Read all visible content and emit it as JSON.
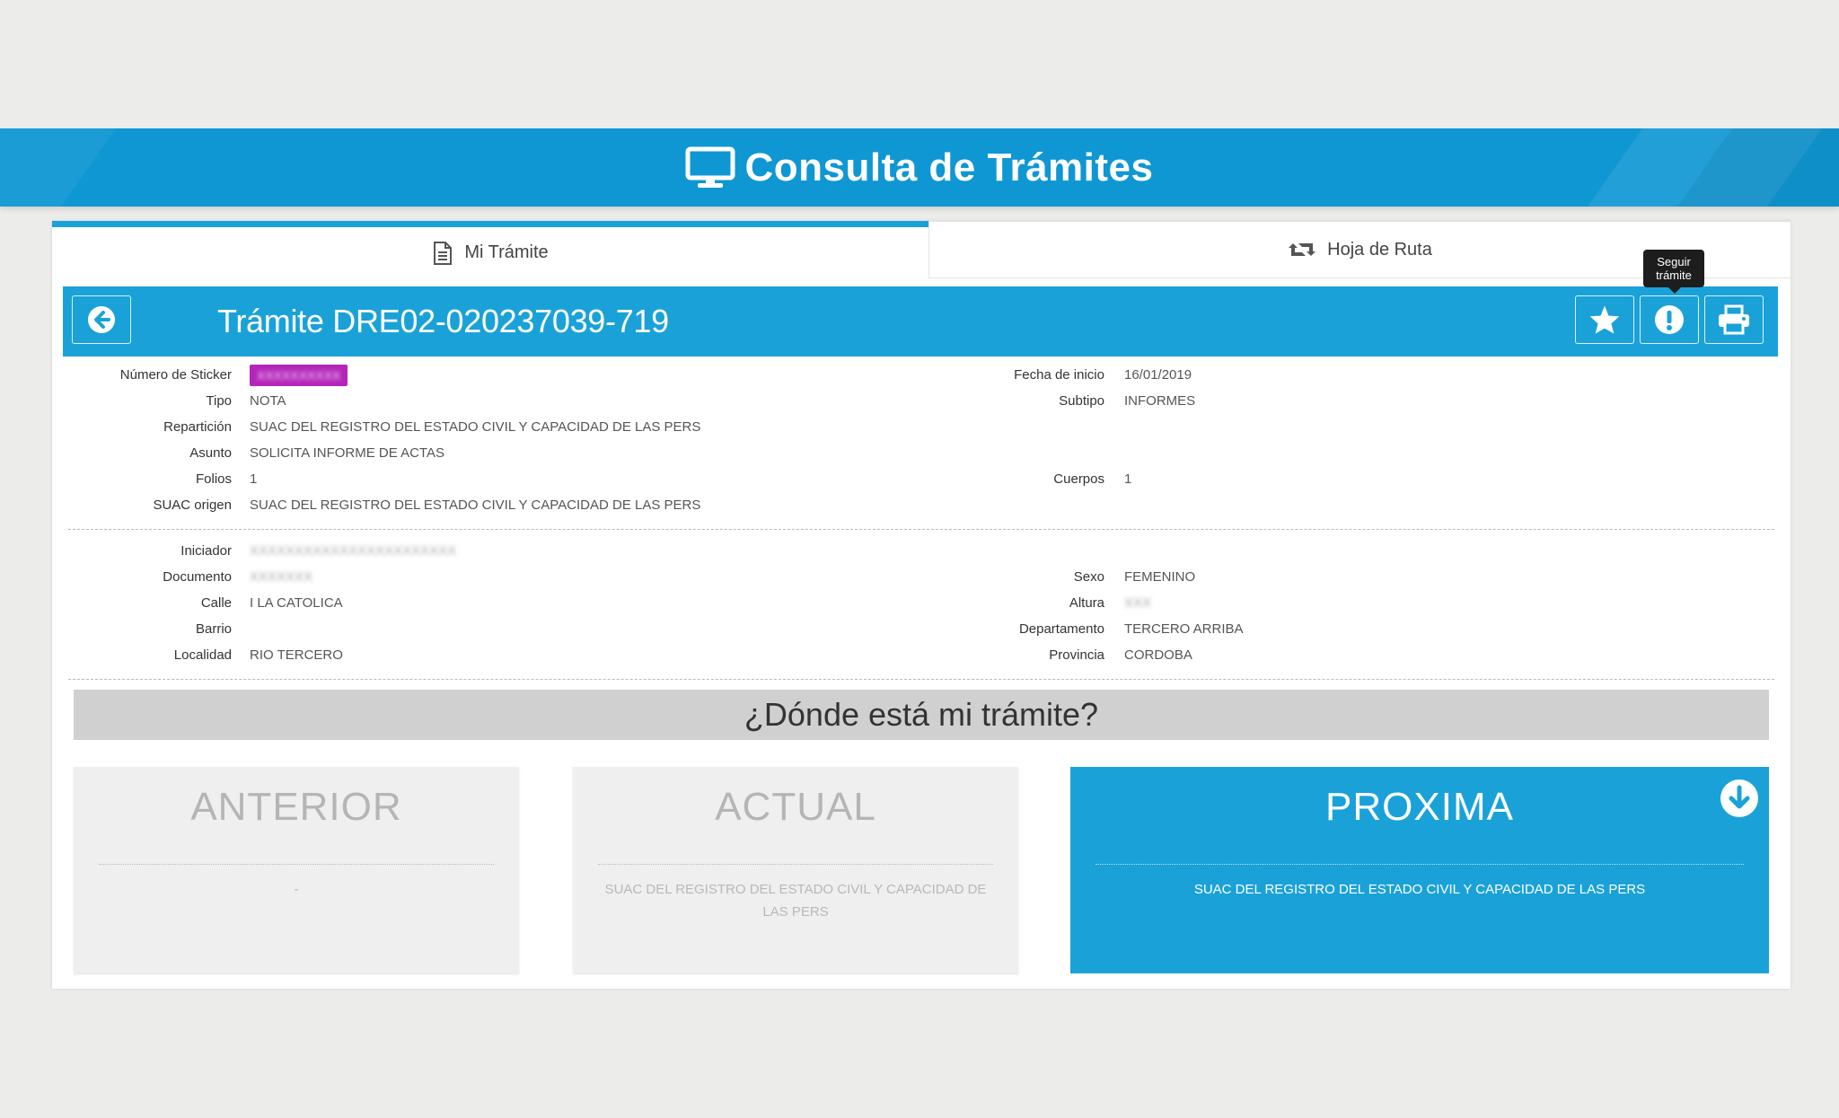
{
  "header": {
    "title": "Consulta de Trámites",
    "icon": "monitor-icon"
  },
  "tabs": [
    {
      "label": "Mi Trámite",
      "icon": "document-icon",
      "active": true
    },
    {
      "label": "Hoja de Ruta",
      "icon": "retweet-icon",
      "active": false
    }
  ],
  "tooltip": {
    "line1": "Seguir",
    "line2": "trámite"
  },
  "title_bar": {
    "title": "Trámite DRE02-020237039-719",
    "actions": [
      {
        "icon": "star-icon",
        "label": "Favorito"
      },
      {
        "icon": "exclamation-icon",
        "label": "Seguir trámite"
      },
      {
        "icon": "print-icon",
        "label": "Imprimir"
      }
    ]
  },
  "details": {
    "sticker_label": "Número de Sticker",
    "sticker_value": "XXXXXXXXXX",
    "tipo_label": "Tipo",
    "tipo_value": "NOTA",
    "reparticion_label": "Repartición",
    "reparticion_value": "SUAC DEL REGISTRO DEL ESTADO CIVIL Y CAPACIDAD DE LAS PERS",
    "asunto_label": "Asunto",
    "asunto_value": "SOLICITA INFORME DE ACTAS",
    "folios_label": "Folios",
    "folios_value": "1",
    "suac_origen_label": "SUAC origen",
    "suac_origen_value": "SUAC DEL REGISTRO DEL ESTADO CIVIL Y CAPACIDAD DE LAS PERS",
    "fecha_label": "Fecha de inicio",
    "fecha_value": "16/01/2019",
    "subtipo_label": "Subtipo",
    "subtipo_value": "INFORMES",
    "cuerpos_label": "Cuerpos",
    "cuerpos_value": "1"
  },
  "iniciador": {
    "iniciador_label": "Iniciador",
    "iniciador_value": "XXXXXXXXXXXXXXXXXXXXXXX",
    "documento_label": "Documento",
    "documento_value": "XXXXXXX",
    "calle_label": "Calle",
    "calle_value": "I LA CATOLICA",
    "barrio_label": "Barrio",
    "barrio_value": "",
    "localidad_label": "Localidad",
    "localidad_value": "RIO TERCERO",
    "sexo_label": "Sexo",
    "sexo_value": "FEMENINO",
    "altura_label": "Altura",
    "altura_value": "XXX",
    "departamento_label": "Departamento",
    "departamento_value": "TERCERO ARRIBA",
    "provincia_label": "Provincia",
    "provincia_value": "CORDOBA"
  },
  "tracking": {
    "question": "¿Dónde está mi trámite?",
    "anterior": {
      "title": "ANTERIOR",
      "text": "-"
    },
    "actual": {
      "title": "ACTUAL",
      "text": "SUAC DEL REGISTRO DEL ESTADO CIVIL Y CAPACIDAD DE LAS PERS"
    },
    "proxima": {
      "title": "PROXIMA",
      "text": "SUAC DEL REGISTRO DEL ESTADO CIVIL Y CAPACIDAD DE LAS PERS"
    }
  },
  "colors": {
    "brand_blue": "#1aa2d8",
    "banner_blue": "#0f97d3",
    "sticker_magenta": "#b425b9",
    "question_grey": "#d0d0d0"
  }
}
